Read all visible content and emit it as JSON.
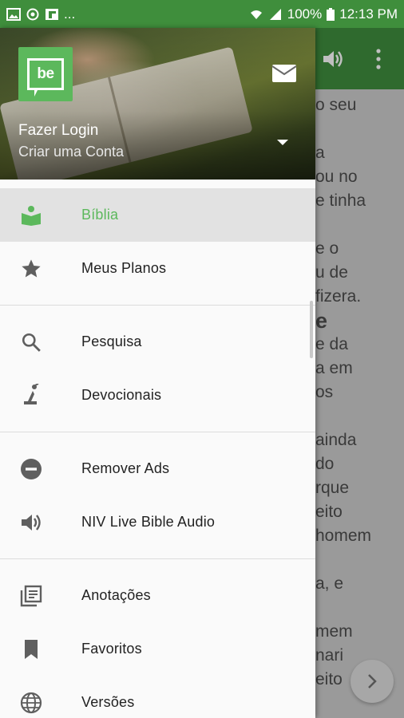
{
  "status_bar": {
    "battery": "100%",
    "time": "12:13 PM",
    "overflow": "..."
  },
  "drawer": {
    "header": {
      "login": "Fazer Login",
      "create_account": "Criar uma Conta",
      "logo_text": "be"
    },
    "items": [
      {
        "label": "Bíblia",
        "icon": "bible-reading-icon",
        "active": true
      },
      {
        "label": "Meus Planos",
        "icon": "star-icon"
      },
      {
        "label": "Pesquisa",
        "icon": "search-icon"
      },
      {
        "label": "Devocionais",
        "icon": "praying-person-icon"
      },
      {
        "label": "Remover Ads",
        "icon": "minus-circle-icon"
      },
      {
        "label": "NIV Live Bible Audio",
        "icon": "speaker-icon"
      },
      {
        "label": "Anotações",
        "icon": "notes-icon"
      },
      {
        "label": "Favoritos",
        "icon": "bookmark-icon"
      },
      {
        "label": "Versões",
        "icon": "globe-icon"
      }
    ]
  },
  "reader": {
    "lines": [
      "o seu",
      "",
      "a",
      "ou no",
      "e tinha",
      "",
      "e o",
      "u de",
      "fizera.",
      "e",
      "e da",
      "a em",
      "os",
      "",
      "ainda",
      "do",
      "rque",
      "eito",
      "homem",
      "",
      "a, e",
      "",
      "mem",
      "nari",
      "eito"
    ]
  },
  "colors": {
    "accent": "#5cb85c",
    "status_bar": "#3f8e3c"
  }
}
